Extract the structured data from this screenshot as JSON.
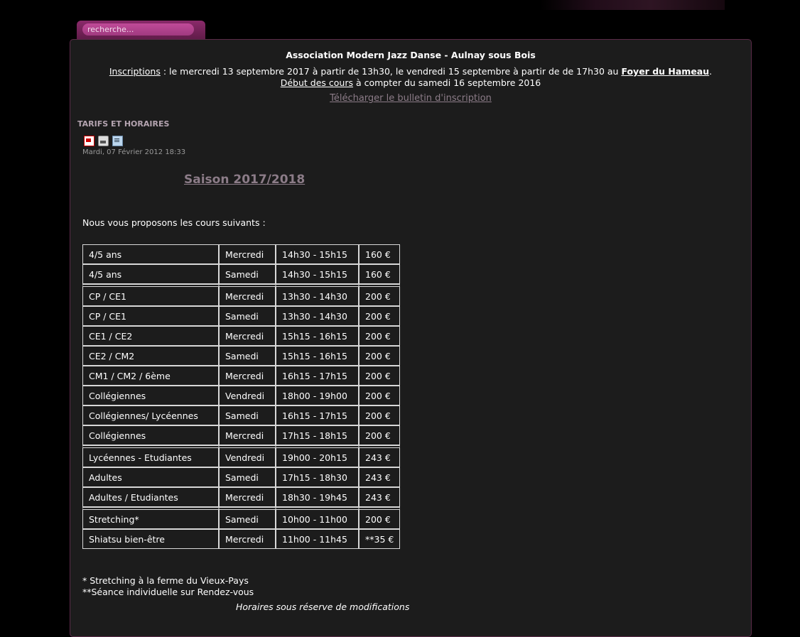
{
  "search": {
    "placeholder": "recherche..."
  },
  "header": {
    "title": "Association Modern Jazz Danse - Aulnay sous Bois",
    "inscriptions_link": "Inscriptions",
    "inscriptions_text": " : le mercredi 13 septembre 2017 à partir de 13h30, le vendredi 15 septembre à partir de de 17h30 au ",
    "foyer_link": "Foyer du Hameau",
    "foyer_suffix": ".",
    "debut_link": "Début des cours",
    "debut_text": " à compter du samedi 16 septembre 2016",
    "download_link": "Télécharger le bulletin d'inscription"
  },
  "article": {
    "section_title": "TARIFS ET HORAIRES",
    "icons": [
      "pdf-icon",
      "print-icon",
      "email-icon"
    ],
    "date": "Mardi, 07 Février 2012 18:33",
    "saison": "Saison 2017/2018",
    "intro": "Nous vous proposons les cours suivants :",
    "courses": [
      {
        "cours": "4/5 ans",
        "jour": "Mercredi",
        "horaire": "14h30 - 15h15",
        "tarif": "160 €"
      },
      {
        "cours": "4/5 ans",
        "jour": "Samedi",
        "horaire": "14h30 - 15h15",
        "tarif": "160 €"
      },
      {
        "cours": "CP / CE1",
        "jour": "Mercredi",
        "horaire": "13h30 - 14h30",
        "tarif": "200 €"
      },
      {
        "cours": "CP / CE1",
        "jour": "Samedi",
        "horaire": "13h30 - 14h30",
        "tarif": "200 €"
      },
      {
        "cours": "CE1 / CE2",
        "jour": "Mercredi",
        "horaire": "15h15 - 16h15",
        "tarif": "200 €"
      },
      {
        "cours": "CE2 / CM2",
        "jour": "Samedi",
        "horaire": "15h15 - 16h15",
        "tarif": "200 €"
      },
      {
        "cours": "CM1 / CM2 / 6ème",
        "jour": "Mercredi",
        "horaire": "16h15 - 17h15",
        "tarif": "200 €"
      },
      {
        "cours": "Collégiennes",
        "jour": "Vendredi",
        "horaire": "18h00 - 19h00",
        "tarif": "200 €"
      },
      {
        "cours": "Collégiennes/ Lycéennes",
        "jour": "Samedi",
        "horaire": "16h15 - 17h15",
        "tarif": "200 €"
      },
      {
        "cours": "Collégiennes",
        "jour": "Mercredi",
        "horaire": "17h15 - 18h15",
        "tarif": "200 €"
      },
      {
        "cours": "Lycéennes - Etudiantes",
        "jour": "Vendredi",
        "horaire": "19h00 - 20h15",
        "tarif": "243 €"
      },
      {
        "cours": "Adultes",
        "jour": "Samedi",
        "horaire": "17h15 - 18h30",
        "tarif": "243 €"
      },
      {
        "cours": "Adultes / Etudiantes",
        "jour": "Mercredi",
        "horaire": "18h30 - 19h45",
        "tarif": "243 €"
      },
      {
        "cours": "Stretching*",
        "jour": "Samedi",
        "horaire": "10h00 - 11h00",
        "tarif": "200 €"
      },
      {
        "cours": "Shiatsu bien-être",
        "jour": "Mercredi",
        "horaire": "11h00 - 11h45",
        "tarif": "**35 €"
      }
    ],
    "note1": "* Stretching à la ferme du Vieux-Pays",
    "note2": "**Séance individuelle sur Rendez-vous",
    "footnote": "Horaires sous réserve de modifications"
  }
}
